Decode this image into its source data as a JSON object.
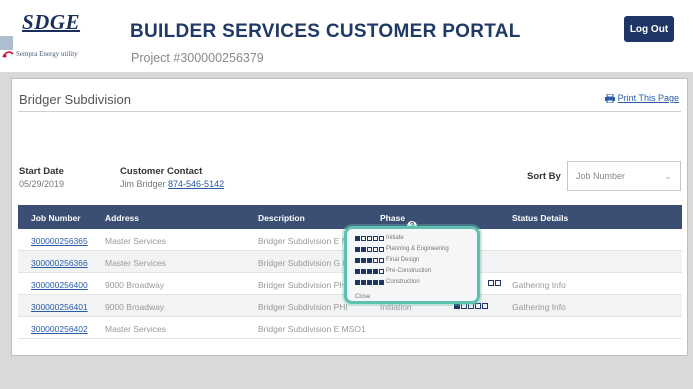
{
  "header": {
    "logo_text": "SDGE",
    "logo_sub": "Sempra Energy utility",
    "title": "BUILDER SERVICES CUSTOMER PORTAL",
    "project": "Project #300000256379",
    "logout_label": "Log Out"
  },
  "panel": {
    "subdivision": "Bridger Subdivision",
    "print_label": "Print This Page",
    "start_date_label": "Start Date",
    "start_date": "05/29/2019",
    "contact_label": "Customer Contact",
    "contact_name": "Jim Bridger",
    "contact_phone": "874-546-5142",
    "sort_label": "Sort By",
    "sort_value": "Job Number"
  },
  "table": {
    "columns": [
      "Job Number",
      "Address",
      "Description",
      "Phase",
      "Status Details"
    ],
    "rows": [
      {
        "job": "300000256365",
        "address": "Master Services",
        "description": "Bridger Subdivision E M",
        "phase": "",
        "status": ""
      },
      {
        "job": "300000256366",
        "address": "Master Services",
        "description": "Bridger Subdivision G M",
        "phase": "",
        "status": ""
      },
      {
        "job": "300000256400",
        "address": "9000 Broadway",
        "description": "Bridger Subdivision PH",
        "phase": "",
        "status": "Gathering Info"
      },
      {
        "job": "300000256401",
        "address": "9000 Broadway",
        "description": "Bridger Subdivision PHI",
        "phase": "Initiation",
        "status": "Gathering Info"
      },
      {
        "job": "300000256402",
        "address": "Master Services",
        "description": "Bridger Subdivision E MSO1",
        "phase": "",
        "status": ""
      }
    ]
  },
  "phase_popup": {
    "items": [
      "Initiate",
      "Planning & Engineering",
      "Final Design",
      "Pre-Construction",
      "Construction"
    ],
    "close_label": "Close"
  },
  "colors": {
    "header_navy": "#1f3566",
    "table_header": "#3a4f73",
    "link_blue": "#2b5ca8",
    "popup_border": "#5fc0b0"
  },
  "icons": {
    "print": "printer-icon",
    "help": "question-circle-icon",
    "sort": "chevron-down-icon"
  }
}
